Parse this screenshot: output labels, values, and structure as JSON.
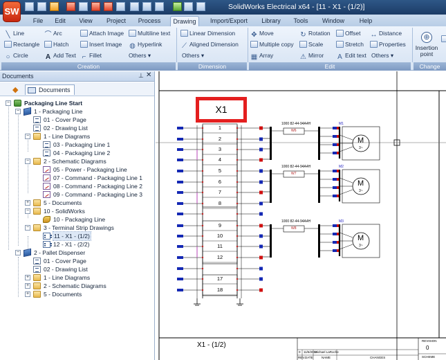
{
  "window": {
    "title": "SolidWorks Electrical x64 - [11 - X1 - (1/2)]",
    "logo": "SW"
  },
  "menu": {
    "tabs": [
      "File",
      "Edit",
      "View",
      "Project",
      "Process",
      "Drawing",
      "Import/Export",
      "Library",
      "Tools",
      "Window",
      "Help"
    ],
    "active": "Drawing"
  },
  "ribbon": {
    "creation": {
      "label": "Creation",
      "items": [
        "Line",
        "Arc",
        "Attach Image",
        "Multiline text",
        "Rectangle",
        "Hatch",
        "Insert Image",
        "Hyperlink",
        "Circle",
        "Add Text",
        "Fillet",
        "Others"
      ]
    },
    "dimension": {
      "label": "Dimension",
      "items": [
        "Linear Dimension",
        "Aligned Dimension",
        "Others"
      ]
    },
    "edit": {
      "label": "Edit",
      "items": [
        "Move",
        "Rotation",
        "Offset",
        "Distance",
        "Multiple copy",
        "Scale",
        "Stretch",
        "Properties",
        "Array",
        "Mirror",
        "Edit text",
        "Others"
      ]
    },
    "change": {
      "label": "Change",
      "insertion_point": "Insertion point"
    }
  },
  "documents_panel": {
    "title": "Documents",
    "tab_label": "Documents",
    "tree": [
      {
        "label": "Packaging Line Start",
        "icon": "project-icon"
      },
      {
        "label": "1 - Packaging Line",
        "icon": "book-icon"
      },
      {
        "label": "01 - Cover Page",
        "icon": "page-icon"
      },
      {
        "label": "02 - Drawing List",
        "icon": "page-icon"
      },
      {
        "label": "1 - Line Diagrams",
        "icon": "folder-icon"
      },
      {
        "label": "03 - Packaging Line 1",
        "icon": "page-icon"
      },
      {
        "label": "04 - Packaging Line 2",
        "icon": "page-icon"
      },
      {
        "label": "2 - Schematic Diagrams",
        "icon": "folder-icon"
      },
      {
        "label": "05 - Power - Packaging Line",
        "icon": "schematic-icon"
      },
      {
        "label": "07 - Command - Packaging Line 1",
        "icon": "schematic-icon"
      },
      {
        "label": "08 - Command - Packaging Line 2",
        "icon": "schematic-icon"
      },
      {
        "label": "09 - Command - Packaging Line 3",
        "icon": "schematic-icon"
      },
      {
        "label": "5 - Documents",
        "icon": "folder-icon"
      },
      {
        "label": "10 - SolidWorks",
        "icon": "folder-icon"
      },
      {
        "label": "10 - Packaging Line",
        "icon": "solidworks-icon"
      },
      {
        "label": "3 - Terminal Strip Drawings",
        "icon": "folder-icon"
      },
      {
        "label": "11 - X1 - (1/2)",
        "icon": "terminal-icon"
      },
      {
        "label": "12 - X1 - (2/2)",
        "icon": "terminal-icon"
      },
      {
        "label": "2 - Pallet Dispenser",
        "icon": "book-icon"
      },
      {
        "label": "01 - Cover Page",
        "icon": "page-icon"
      },
      {
        "label": "02 - Drawing List",
        "icon": "page-icon"
      },
      {
        "label": "1 - Line Diagrams",
        "icon": "folder-icon"
      },
      {
        "label": "2 - Schematic Diagrams",
        "icon": "folder-icon"
      },
      {
        "label": "5 - Documents",
        "icon": "folder-icon"
      }
    ]
  },
  "drawing": {
    "terminal_strip": "X1",
    "terminals": [
      "1",
      "2",
      "3",
      "4",
      "5",
      "6",
      "7",
      "8",
      "9",
      "10",
      "11",
      "12",
      "17",
      "18"
    ],
    "devices": [
      {
        "label": "1000 82-44-94A4H",
        "ref": "W6",
        "motor": "M1"
      },
      {
        "label": "1000 82-44-94A4H",
        "ref": "W7",
        "motor": "M2"
      },
      {
        "label": "1000 82-44-94A4H",
        "ref": "W8",
        "motor": "M3"
      }
    ],
    "motor_letter": "M",
    "motor_sub": "3~",
    "sheet_name": "X1 - (1/2)",
    "title_block": {
      "rev": "0",
      "date": "11/6/2012",
      "name": "Michael LaRoche",
      "headers": [
        "REV.",
        "DATE",
        "NAME",
        "CHANGES"
      ],
      "revision_label": "REVISION",
      "revision_value": "0",
      "scheme_label": "SCHEME"
    }
  }
}
